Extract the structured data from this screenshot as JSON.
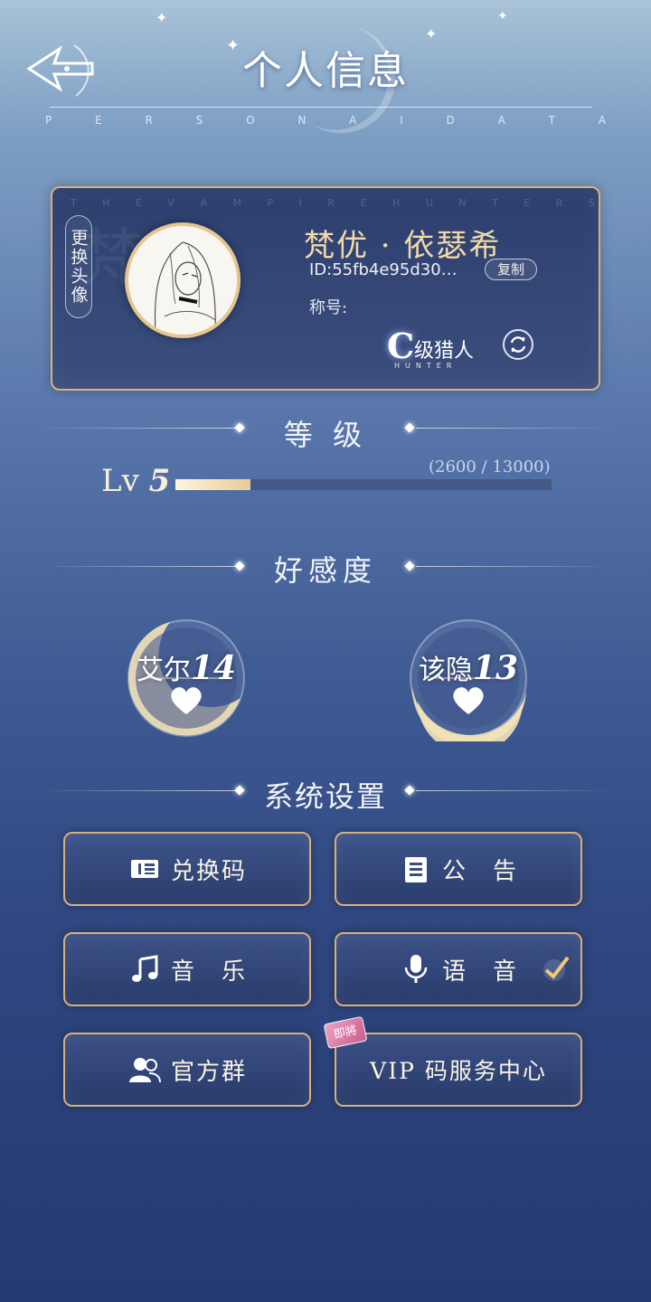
{
  "header": {
    "title": "个人信息",
    "subtitle_letters": [
      "P",
      "E",
      "R",
      "S",
      "O",
      "N",
      "A",
      "I",
      "D",
      "A",
      "T",
      "A"
    ]
  },
  "profile": {
    "watermark_letters": [
      "T",
      "H",
      "E",
      "V",
      "A",
      "M",
      "P",
      "I",
      "R",
      "E",
      "H",
      "U",
      "N",
      "T",
      "E",
      "R",
      "S"
    ],
    "watermark_big": "梵优",
    "change_avatar_label": "更换头像",
    "name": "梵优 · 依瑟希",
    "id": "ID:55fb4e95d30…",
    "copy_label": "复制",
    "title_label": "称号:",
    "hunter_grade": "C",
    "hunter_text": "级猎人",
    "hunter_sub": "HUNTER"
  },
  "level": {
    "section_title": "等 级",
    "lv_prefix": "Lv",
    "lv_value": "5",
    "xp_text": "(2600 / 13000)",
    "xp_current": 2600,
    "xp_max": 13000
  },
  "affection": {
    "section_title": "好感度",
    "characters": [
      {
        "name": "艾尔",
        "value": "14"
      },
      {
        "name": "该隐",
        "value": "13"
      }
    ]
  },
  "settings": {
    "section_title": "系统设置",
    "buttons": [
      {
        "label": "兑换码",
        "icon": "ticket-icon"
      },
      {
        "label": "公　告",
        "icon": "notice-icon"
      },
      {
        "label": "音　乐",
        "icon": "music-icon"
      },
      {
        "label": "语　音",
        "icon": "microphone-icon"
      },
      {
        "label": "官方群",
        "icon": "group-icon"
      },
      {
        "label": "VIP 码服务中心",
        "icon": "vip-icon"
      }
    ],
    "new_badge": "即將"
  },
  "colors": {
    "gold": "#d9b27a",
    "card_bg": "#2d3f6e",
    "name_gold": "#f1d9a8"
  }
}
